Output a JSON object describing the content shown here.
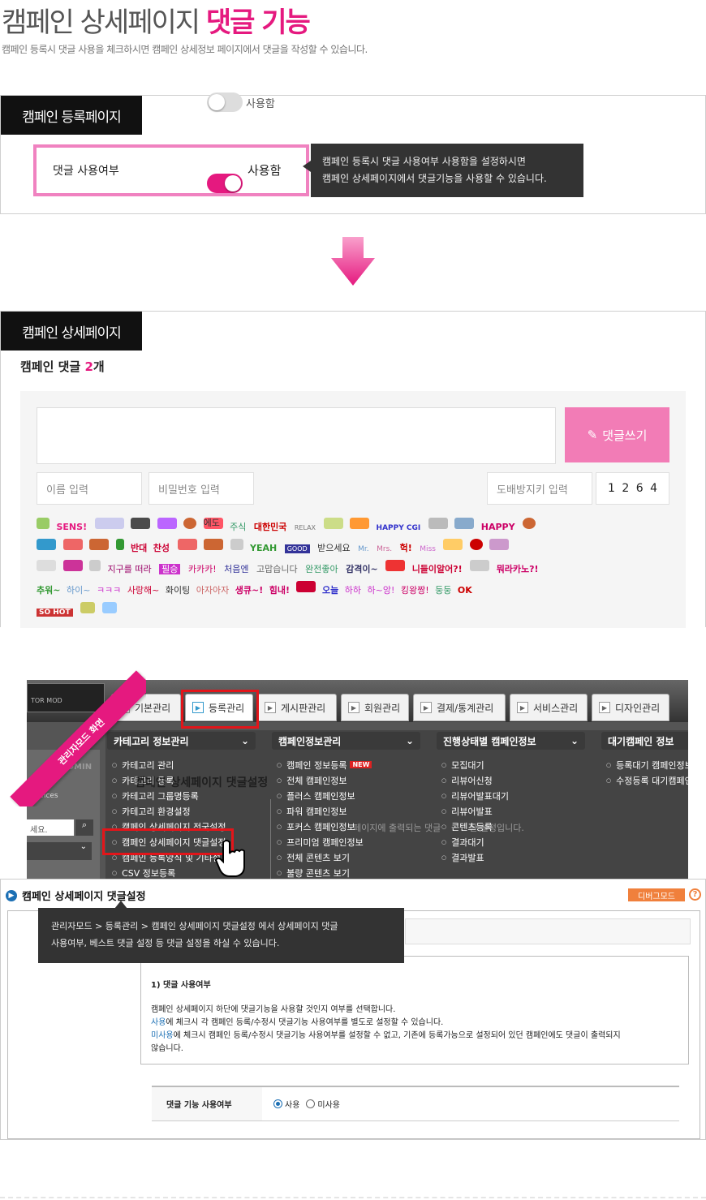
{
  "header": {
    "title_main": "캠페인 상세페이지",
    "title_highlight": "댓글 기능",
    "subtitle": "캠페인 등록시 댓글 사용을 체크하시면 캠페인 상세정보 페이지에서 댓글을 작성할 수 있습니다."
  },
  "register_panel": {
    "tag": "캠페인 등록페이지",
    "ghost_toggle_label": "사용함",
    "row_label": "댓글 사용여부",
    "toggle_label": "사용함",
    "toggle_on": true,
    "tooltip_line1": "캠페인 등록시 댓글 사용여부 사용함을 설정하시면",
    "tooltip_line2": "캠페인 상세페이지에서 댓글기능을 사용할 수 있습니다."
  },
  "detail_panel": {
    "tag": "캠페인 상세페이지",
    "comment_prefix": "캠페인 댓글 ",
    "comment_count": "2",
    "comment_suffix": "개",
    "write_button": "댓글쓰기",
    "name_placeholder": "이름 입력",
    "password_placeholder": "비밀번호 입력",
    "captcha_placeholder": "도배방지키 입력",
    "captcha_code": "1 2 6 4",
    "emoticons": {
      "row1": [
        "SENS!",
        "HAPPY CGI",
        "HAPPY",
        "주식",
        "대한민국",
        "RELAX",
        "에도"
      ],
      "row2": [
        "반대",
        "찬성",
        "YEAH",
        "GOOD",
        "받으세요",
        "Mr.",
        "Mrs.",
        "헉!",
        "Miss"
      ],
      "row3": [
        "지구를 떠라",
        "필승",
        "카카카!",
        "처음엔",
        "고맙습니다",
        "완전좋아",
        "감격이~",
        "니들이알어?!",
        "뭐라카노?!"
      ],
      "row4": [
        "추워~",
        "하이~",
        "ㅋㅋㅋ",
        "사랑해~",
        "화이팅",
        "아자아자",
        "생큐~!",
        "힘내!",
        "오늘",
        "하하",
        "하~앙!",
        "킹왕짱!",
        "둥둥",
        "OK"
      ],
      "row5": [
        "SO HOT"
      ]
    }
  },
  "admin_screenshot": {
    "ribbon": "관리자모드 화면",
    "brand_text": "TOR MOD",
    "admin_text": "ADMIN",
    "search_placeholder": "세요.",
    "side_label": "ferences",
    "tabs": [
      "기본관리",
      "등록관리",
      "게시판관리",
      "회원관리",
      "결제/통계관리",
      "서비스관리",
      "디자인관리"
    ],
    "menus": [
      {
        "head": "카테고리 정보관리",
        "items": [
          "카테고리 관리",
          "카테고리 등록",
          "카테고리 그룹명등록",
          "카테고리 환경설정",
          "캠페인 상세페이지 전국설정",
          "캠페인 상세페이지 댓글설정",
          "캠페인 등록양식 및 기타설",
          "CSV 정보등록"
        ]
      },
      {
        "head": "캠페인정보관리",
        "items": [
          "캠페인 정보등록",
          "전체 캠페인정보",
          "플러스 캠페인정보",
          "파워 캠페인정보",
          "포커스 캠페인정보",
          "프리미엄 캠페인정보",
          "전체 콘텐츠 보기",
          "불량 콘텐츠 보기"
        ]
      },
      {
        "head": "진행상태별 캠페인정보",
        "items": [
          "모집대기",
          "리뷰어신청",
          "리뷰어발표대기",
          "리뷰어발표",
          "콘텐츠등록",
          "결과대기",
          "결과발표"
        ]
      },
      {
        "head": "대기캠페인 정보",
        "items": [
          "등록대기 캠페인정보",
          "수정등록 대기캠페인"
        ]
      }
    ],
    "new_badge": "NEW",
    "bg_title": "캠페인 상세페이지 댓글설정",
    "bg_desc_fragment": "페이지에 출력되는 댓글",
    "bg_desc_end": "된 설정입니다."
  },
  "settings_screenshot": {
    "title": "캠페인 상세페이지 댓글설정",
    "debug_button": "디버그모드",
    "help_icon_label": "?",
    "tooltip_line1": "관리자모드 > 등록관리 > 캠페인 상세페이지 댓글설정 에서 상세페이지 댓글",
    "tooltip_line2": "사용여부, 베스트 댓글 설정 등 댓글 설정을 하실 수 있습니다.",
    "section_heading": "1) 댓글 사용여부",
    "desc1": "캠페인 상세페이지 하단에 댓글기능을 사용할 것인지 여부를 선택합니다.",
    "desc2_hl": "사용",
    "desc2": "에 체크시 각 캠페인 등록/수정시 댓글기능 사용여부를 별도로 설정할 수 있습니다.",
    "desc3_hl": "미사용",
    "desc3": "에 체크시 캠페인 등록/수정시 댓글기능 사용여부를 설정할 수 없고, 기존에 등록가능으로 설정되어 있던 캠페인에도 댓글이 출력되지",
    "desc4": "않습니다.",
    "form_label": "댓글 기능 사용여부",
    "opt_use": "사용",
    "opt_nouse": "미사용",
    "selected": "사용"
  },
  "colors": {
    "accent": "#e5197f",
    "button": "#f27cb6",
    "dark_tag": "#111111",
    "red_box": "#e3151a"
  }
}
